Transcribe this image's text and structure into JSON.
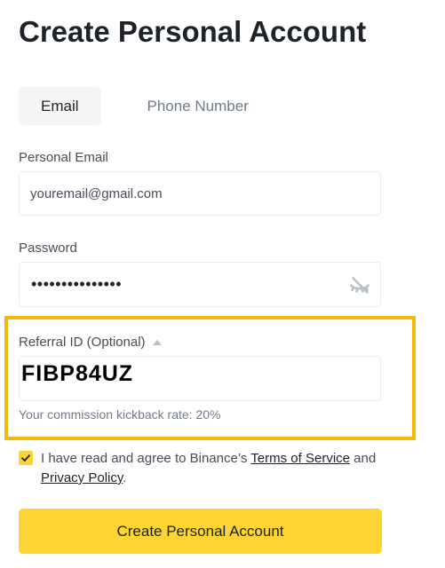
{
  "page": {
    "title": "Create Personal Account"
  },
  "tabs": [
    {
      "label": "Email",
      "active": true
    },
    {
      "label": "Phone Number",
      "active": false
    }
  ],
  "email_field": {
    "label": "Personal Email",
    "placeholder": "youremail@gmail.com",
    "value": ""
  },
  "password_field": {
    "label": "Password",
    "masked_value": "•••••••••••••••",
    "toggle_icon": "eye-slash-icon"
  },
  "referral": {
    "label": "Referral ID (Optional)",
    "expand_icon": "caret-up-icon",
    "value": "FIBP84UZ",
    "commission_text": "Your commission kickback rate: 20%"
  },
  "agreement": {
    "checked": true,
    "text_before": "I have read and agree to Binance’s ",
    "terms_link": "Terms of Service",
    "text_middle": " and ",
    "privacy_link": "Privacy Policy",
    "text_after": "."
  },
  "submit": {
    "label": "Create Personal Account"
  },
  "colors": {
    "accent": "#fcd535",
    "highlight_border": "#f0b90b",
    "text_primary": "#1e2329",
    "text_secondary": "#474d57",
    "text_muted": "#707a8a",
    "border": "#eaecef"
  }
}
